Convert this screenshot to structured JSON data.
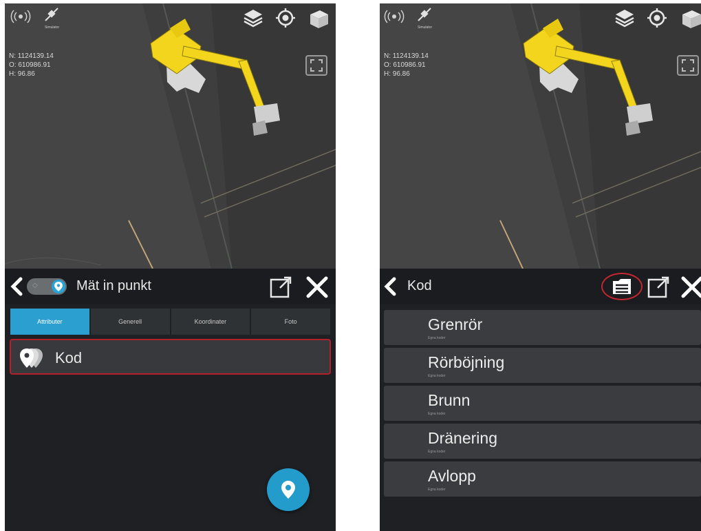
{
  "left_screen": {
    "map": {
      "coords": [
        "N: 1124139.14",
        "O: 610986.91",
        "H: 96.86"
      ],
      "sim_label": "Simulator",
      "icons": [
        "gps-signal-icon",
        "satellite-icon",
        "layers-icon",
        "locate-icon",
        "3d-view-icon",
        "fit-view-icon"
      ]
    },
    "header": {
      "title": "Mät in punkt"
    },
    "tabs": [
      {
        "label": "Attributer",
        "active": true
      },
      {
        "label": "Generell",
        "active": false
      },
      {
        "label": "Koordinater",
        "active": false
      },
      {
        "label": "Foto",
        "active": false
      }
    ],
    "attribute_row": {
      "label": "Kod"
    }
  },
  "right_screen": {
    "map": {
      "coords": [
        "N: 1124139.14",
        "O: 610986.91",
        "H: 96.86"
      ],
      "sim_label": "Simulator"
    },
    "header": {
      "title": "Kod"
    },
    "code_list": [
      {
        "name": "Grenrör",
        "sub": "Egna koder"
      },
      {
        "name": "Rörböjning",
        "sub": "Egna koder"
      },
      {
        "name": "Brunn",
        "sub": "Egna koder"
      },
      {
        "name": "Dränering",
        "sub": "Egna koder"
      },
      {
        "name": "Avlopp",
        "sub": "Egna koder"
      }
    ]
  },
  "colors": {
    "accent": "#2a9fd0",
    "highlight_border": "#b3202a",
    "machine_yellow": "#f2d51c"
  }
}
